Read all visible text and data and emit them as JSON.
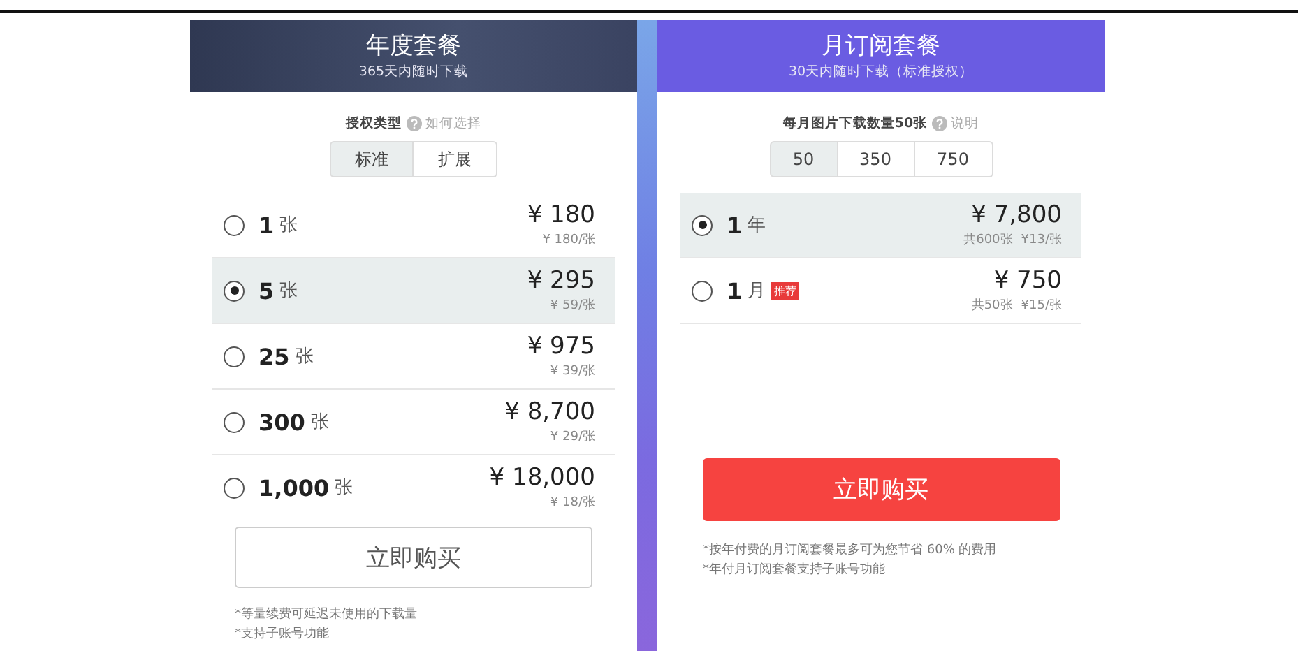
{
  "plans": [
    {
      "kind": "dark",
      "title": "年度套餐",
      "subtitle": "365天内随时下载",
      "option_label": "授权类型",
      "help_link": "如何选择",
      "segments": [
        {
          "label": "标准",
          "selected": true
        },
        {
          "label": "扩展",
          "selected": false
        }
      ],
      "options": [
        {
          "quantity": "1",
          "unit": "张",
          "price": "¥ 180",
          "details": [
            "¥ 180/张"
          ],
          "selected": false
        },
        {
          "quantity": "5",
          "unit": "张",
          "price": "¥ 295",
          "details": [
            "¥ 59/张"
          ],
          "selected": true
        },
        {
          "quantity": "25",
          "unit": "张",
          "price": "¥ 975",
          "details": [
            "¥ 39/张"
          ],
          "selected": false
        },
        {
          "quantity": "300",
          "unit": "张",
          "price": "¥ 8,700",
          "details": [
            "¥ 29/张"
          ],
          "selected": false
        },
        {
          "quantity": "1,000",
          "unit": "张",
          "price": "¥ 18,000",
          "details": [
            "¥ 18/张"
          ],
          "selected": false
        }
      ],
      "button": {
        "label": "立即购买",
        "kind": "outline"
      },
      "notes": [
        "*等量续费可延迟未使用的下载量",
        "*支持子账号功能"
      ]
    },
    {
      "kind": "violet",
      "title": "月订阅套餐",
      "subtitle": "30天内随时下载（标准授权）",
      "option_label": "每月图片下载数量50张",
      "help_link": "说明",
      "segments": [
        {
          "label": "50",
          "selected": true
        },
        {
          "label": "350",
          "selected": false
        },
        {
          "label": "750",
          "selected": false
        }
      ],
      "options": [
        {
          "quantity": "1",
          "unit": "年",
          "price": "¥ 7,800",
          "details": [
            "共600张",
            "¥13/张"
          ],
          "selected": true
        },
        {
          "quantity": "1",
          "unit": "月",
          "tag": "推荐",
          "price": "¥ 750",
          "details": [
            "共50张",
            "¥15/张"
          ],
          "selected": false
        }
      ],
      "button": {
        "label": "立即购买",
        "kind": "filled"
      },
      "notes": [
        "*按年付费的月订阅套餐最多可为您节省 60% 的费用",
        "*年付月订阅套餐支持子账号功能"
      ]
    }
  ]
}
